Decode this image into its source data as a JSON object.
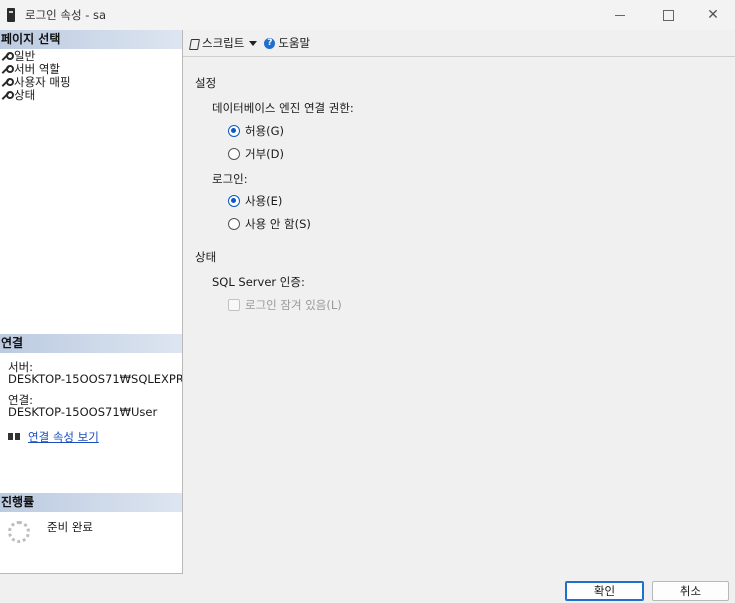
{
  "window": {
    "title": "로그인 속성 - sa"
  },
  "left": {
    "page_select_header": "페이지 선택",
    "pages": [
      {
        "label": "일반"
      },
      {
        "label": "서버 역할"
      },
      {
        "label": "사용자 매핑"
      },
      {
        "label": "상태"
      }
    ],
    "connection_header": "연결",
    "server_label": "서버:",
    "server_value": "DESKTOP-15OOS71₩SQLEXPR",
    "connection_label": "연결:",
    "connection_value": "DESKTOP-15OOS71₩User",
    "view_conn_props": "연결 속성 보기",
    "progress_header": "진행률",
    "progress_status": "준비 완료"
  },
  "toolbar": {
    "script_label": "스크립트",
    "help_label": "도움말"
  },
  "settings": {
    "section_label": "설정",
    "db_permission_label": "데이터베이스 엔진 연결 권한:",
    "grant_label": "허용(G)",
    "deny_label": "거부(D)",
    "login_label": "로그인:",
    "enabled_label": "사용(E)",
    "disabled_label": "사용 안 함(S)",
    "grant_selected": true,
    "enabled_selected": true
  },
  "status": {
    "section_label": "상태",
    "sql_auth_label": "SQL Server 인증:",
    "locked_out_label": "로그인 잠겨 있음(L)"
  },
  "buttons": {
    "ok": "확인",
    "cancel": "취소"
  },
  "colors": {
    "accent": "#0c58c5",
    "link": "#1a4dbf",
    "header_gradient_start": "#bccbe1"
  }
}
